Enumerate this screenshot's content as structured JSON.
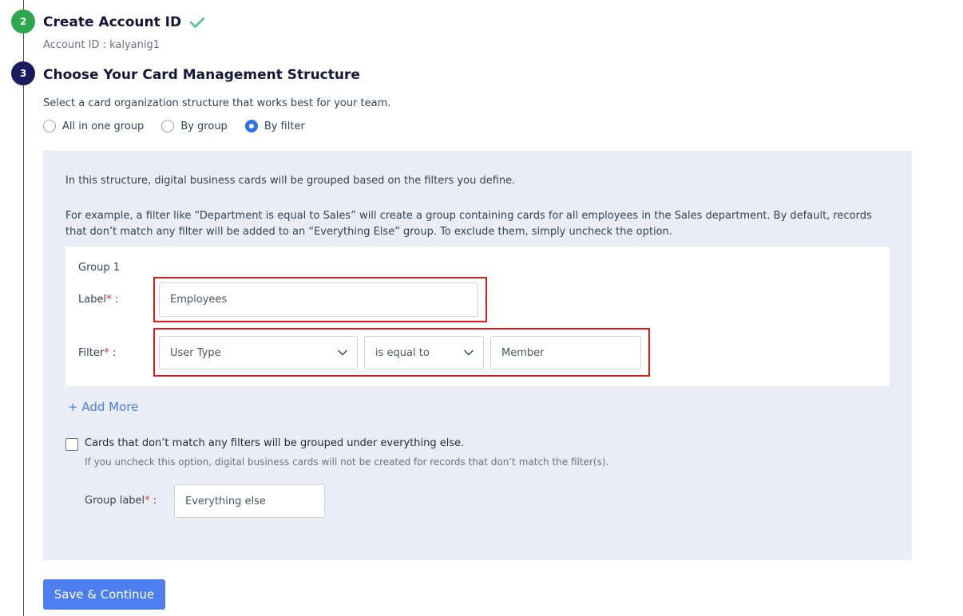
{
  "step2": {
    "number": "2",
    "title": "Create Account ID",
    "icon": "check-icon",
    "account_id_text": "Account ID : kalyanig1",
    "color": "#2ea84f"
  },
  "step3": {
    "number": "3",
    "title": "Choose Your Card Management Structure",
    "description": "Select a card organization structure that works best for your team.",
    "color": "#1a1a5e",
    "radio_options": [
      {
        "label": "All in one group",
        "selected": false
      },
      {
        "label": "By group",
        "selected": false
      },
      {
        "label": "By filter",
        "selected": true
      }
    ]
  },
  "panel": {
    "info1": "In this structure, digital business cards will be grouped based on the filters you define.",
    "info2": "For example, a filter like “Department is equal to Sales” will create a group containing cards for all employees in the Sales department. By default, records that don’t match any filter will be added to an “Everything Else” group. To exclude them, simply uncheck the option.",
    "group": {
      "title": "Group 1",
      "label_field_label": "Label",
      "label_value": "Employees",
      "filter_field_label": "Filter",
      "filter_field": "User Type",
      "filter_operator": "is equal to",
      "filter_value": "Member",
      "required_mark": "*",
      "separator": " :"
    },
    "add_more": "+ Add More",
    "everything_else": {
      "checked": false,
      "text": "Cards that don’t match any filters will be grouped under everything else.",
      "help": "If you uncheck this option, digital business cards will not be created for records that don’t match the filter(s).",
      "group_label_label": "Group label",
      "group_label_value": "Everything else"
    }
  },
  "save_button": "Save & Continue",
  "colors": {
    "accent": "#4d7ef0",
    "highlight": "#dd1b1b",
    "panel_bg": "#eaedf6"
  }
}
